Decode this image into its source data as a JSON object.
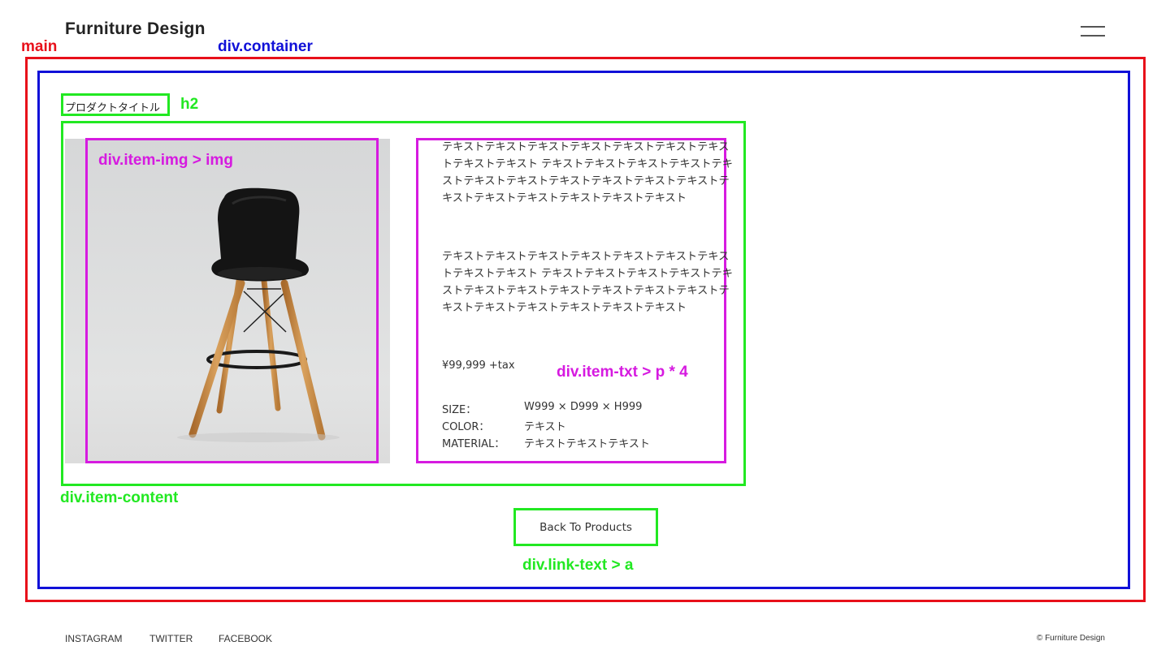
{
  "header": {
    "site_title": "Furniture Design",
    "menu_icon": "hamburger-menu-icon"
  },
  "annotations": {
    "main": "main",
    "container": "div.container",
    "h2": "h2",
    "item_img": "div.item-img > img",
    "item_txt": "div.item-txt > p * 4",
    "item_content": "div.item-content",
    "link_text": "div.link-text > a"
  },
  "annotation_colors": {
    "main": "#e8101a",
    "container": "#1010d8",
    "green": "#22e822",
    "magenta": "#d61ae0"
  },
  "product": {
    "title": "プロダクトタイトル",
    "image_alt": "black chair with wooden legs",
    "paragraph1": "テキストテキストテキストテキストテキストテキストテキストテキストテキスト テキストテキストテキストテキストテキストテキストテキストテキストテキストテキストテキストテキストテキストテキストテキストテキストテキスト",
    "paragraph2": "テキストテキストテキストテキストテキストテキストテキストテキストテキスト テキストテキストテキストテキストテキストテキストテキストテキストテキストテキストテキストテキストテキストテキストテキストテキストテキスト",
    "price": "¥99,999 +tax",
    "specs": [
      {
        "key": "SIZE：",
        "value": "W999 × D999 × H999"
      },
      {
        "key": "COLOR：",
        "value": "テキスト"
      },
      {
        "key": "MATERIAL：",
        "value": "テキストテキストテキスト"
      }
    ]
  },
  "back_link": "Back To Products",
  "footer": {
    "links": [
      "INSTAGRAM",
      "TWITTER",
      "FACEBOOK"
    ],
    "copyright": "© Furniture Design"
  }
}
